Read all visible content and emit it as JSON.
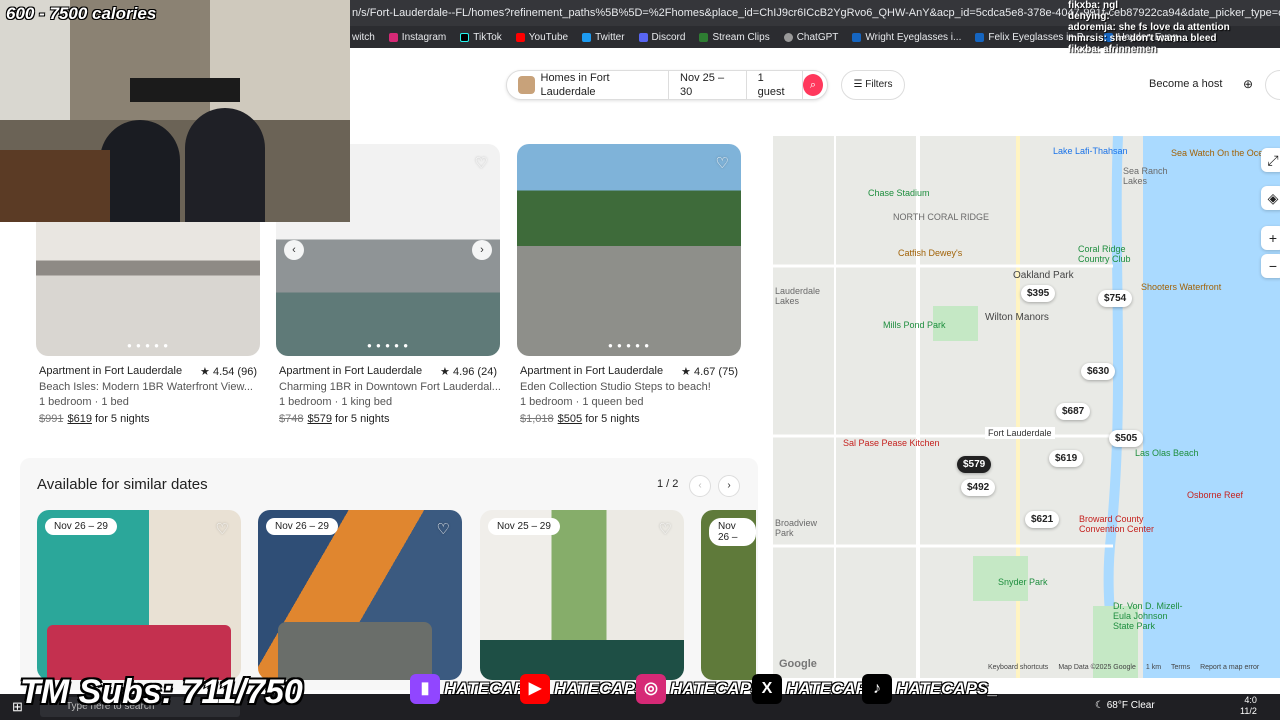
{
  "browser": {
    "url": "n/s/Fort-Lauderdale--FL/homes?refinement_paths%5B%5D=%2Fhomes&place_id=ChIJ9cr6ICcB2YgRvo6_QHW-AnY&acp_id=5cdca5e8-378e-4047-991f-ceb87922ca94&date_picker_type=calendar&checkin=2025-11-",
    "bookmarks": [
      "witch",
      "Instagram",
      "TikTok",
      "YouTube",
      "Twitter",
      "Discord",
      "Stream Clips",
      "ChatGPT",
      "Wright Eyeglasses i...",
      "Felix Eyeglasses in P...",
      "Hayden Eyeg"
    ]
  },
  "header": {
    "location": "Homes in Fort Lauderdale",
    "dates": "Nov 25 – 30",
    "guests": "1 guest",
    "filters": "Filters",
    "host": "Become a host"
  },
  "listings": [
    {
      "type": "Apartment in Fort Lauderdale",
      "rating": "4.54 (96)",
      "title": "Beach Isles: Modern 1BR Waterfront View...",
      "details": "1 bedroom · 1 bed",
      "old_price": "$991",
      "price": "$619",
      "nights": "for 5 nights",
      "color": "#cfc9c1"
    },
    {
      "type": "Apartment in Fort Lauderdale",
      "rating": "4.96 (24)",
      "title": "Charming 1BR in Downtown Fort Lauderdal...",
      "details": "1 bedroom · 1 king bed",
      "old_price": "$748",
      "price": "$579",
      "nights": "for 5 nights",
      "color": "#b9bbbd"
    },
    {
      "type": "Apartment in Fort Lauderdale",
      "rating": "4.67 (75)",
      "title": "Eden Collection Studio Steps to beach!",
      "details": "1 bedroom · 1 queen bed",
      "old_price": "$1,018",
      "price": "$505",
      "nights": "for 5 nights",
      "color": "#7f8b74"
    }
  ],
  "similar": {
    "title": "Available for similar dates",
    "pager": "1 / 2",
    "cards": [
      {
        "dates": "Nov 26 – 29",
        "color": "#2ba79a"
      },
      {
        "dates": "Nov 26 – 29",
        "color": "#c97a3c"
      },
      {
        "dates": "Nov 25 – 29",
        "color": "#4f6b5e"
      },
      {
        "dates": "Nov 26 –",
        "color": "#5f7a3a"
      }
    ]
  },
  "map": {
    "pins": [
      "$395",
      "$754",
      "$630",
      "$687",
      "$505",
      "$619",
      "$579",
      "$492",
      "$621"
    ],
    "place_labels": [
      "Lake Lafi-Thahsan",
      "Sea Ranch Lakes",
      "Chase Stadium",
      "NORTH CORAL RIDGE",
      "Coral Ridge Country Club",
      "Lauderdale Lakes",
      "Catfish Dewey's",
      "Oakland Park",
      "Shooters Waterfront",
      "Wilton Manors",
      "Mills Pond Park",
      "Fort Lauderdale",
      "Sal Pase Pease Kitchen",
      "Las Olas Beach",
      "Osborne Reef",
      "Broadview Park",
      "Broward County Convention Center",
      "Snyder Park",
      "Dr. Von D. Mizell-Eula Johnson State Park",
      "Sea Watch On the Ocean"
    ],
    "footer": [
      "Keyboard shortcuts",
      "Map Data ©2025 Google",
      "1 km",
      "Terms",
      "Report a map error"
    ],
    "google": "Google"
  },
  "stream": {
    "calories": "600 - 7500 calories",
    "chat": [
      "fikxba: ngl",
      "denying:",
      "adoremja: she fs love da attention",
      "mmrsis: she don't wanna bleed",
      "fikxba: afrinnemen"
    ],
    "subs": "TM Subs: 711/750",
    "socials": [
      {
        "name": "HATECAPS",
        "icon": "twitch-icon",
        "color": "#9146ff",
        "glyph": "▮"
      },
      {
        "name": "HATECAPS",
        "icon": "youtube-icon",
        "color": "#ff0000",
        "glyph": "▶"
      },
      {
        "name": "HATECAPSX",
        "icon": "instagram-icon",
        "color": "#d62976",
        "glyph": "◎"
      },
      {
        "name": "HATECAPSS",
        "icon": "x-icon",
        "color": "#000000",
        "glyph": "𝕏"
      },
      {
        "name": "HATECAPS_",
        "icon": "tiktok-icon",
        "color": "#000000",
        "glyph": "♪"
      }
    ]
  },
  "taskbar": {
    "search": "Type here to search",
    "weather": "68°F Clear",
    "time": "4:0",
    "date": "11/2"
  }
}
